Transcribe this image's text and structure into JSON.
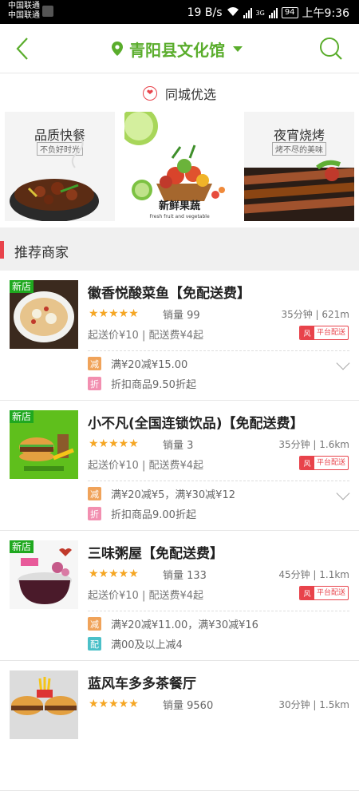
{
  "statusbar": {
    "carrier1": "中国联通",
    "carrier2": "中国联通",
    "speed": "19 B/s",
    "net": "3G",
    "battery": "94",
    "time": "上午9:36"
  },
  "header": {
    "location": "青阳县文化馆",
    "accent": "#5aad2c"
  },
  "banner": {
    "title": "同城优选",
    "promos": [
      {
        "title": "品质快餐",
        "subtitle": "不负好时光"
      },
      {
        "title": "新鲜果蔬",
        "subtitle": "Fresh fruit and vegetable"
      },
      {
        "title": "夜宵烧烤",
        "subtitle": "烤不尽的美味"
      }
    ]
  },
  "recommend": {
    "title": "推荐商家"
  },
  "shops": [
    {
      "new_tag": "新店",
      "name": "徽香悦酸菜鱼【免配送费】",
      "sales": "销量 99",
      "distance": "35分钟 | 621m",
      "fee": "起送价¥10 | 配送费¥4起",
      "platform_icon": "风",
      "platform": "平台配送",
      "activities": [
        {
          "badge": "减",
          "text": "满¥20减¥15.00"
        },
        {
          "badge": "折",
          "text": "折扣商品9.50折起"
        }
      ]
    },
    {
      "new_tag": "新店",
      "name": "小不凡(全国连锁饮品)【免配送费】",
      "sales": "销量 3",
      "distance": "35分钟 | 1.6km",
      "fee": "起送价¥10 | 配送费¥4起",
      "platform_icon": "风",
      "platform": "平台配送",
      "activities": [
        {
          "badge": "减",
          "text": "满¥20减¥5，满¥30减¥12"
        },
        {
          "badge": "折",
          "text": "折扣商品9.00折起"
        }
      ]
    },
    {
      "new_tag": "新店",
      "name": "三味粥屋【免配送费】",
      "sales": "销量 133",
      "distance": "45分钟 | 1.1km",
      "fee": "起送价¥10 | 配送费¥4起",
      "platform_icon": "风",
      "platform": "平台配送",
      "activities": [
        {
          "badge": "减",
          "text": "满¥20减¥11.00，满¥30减¥16"
        },
        {
          "badge": "配",
          "text": "满00及以上减4"
        }
      ]
    },
    {
      "name": "蓝风车多多茶餐厅",
      "sales": "销量 9560",
      "distance": "30分钟 | 1.5km"
    }
  ],
  "stars": "★★★★★"
}
